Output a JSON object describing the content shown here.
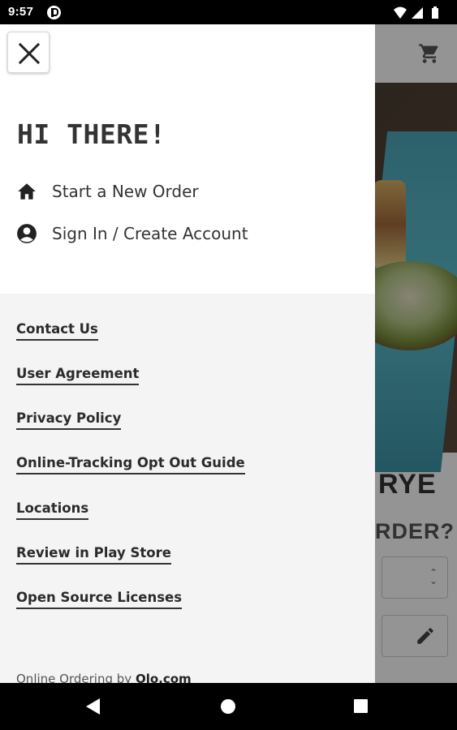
{
  "status_bar": {
    "time": "9:57"
  },
  "background": {
    "title_fragment": "RYE",
    "subtitle_fragment": "RDER?"
  },
  "drawer": {
    "greeting": "HI THERE!",
    "primary_items": [
      {
        "label": "Start a New Order",
        "icon": "home-icon"
      },
      {
        "label": "Sign In / Create Account",
        "icon": "account-circle-icon"
      }
    ],
    "links": [
      "Contact Us",
      "User Agreement",
      "Privacy Policy",
      "Online-Tracking Opt Out Guide",
      "Locations",
      "Review in Play Store",
      "Open Source Licenses"
    ],
    "footer_prefix": "Online Ordering by",
    "footer_brand": "Olo.com"
  },
  "colors": {
    "drawer_top": "#ffffff",
    "drawer_body": "#f4f4f4",
    "text_dark": "#333333"
  }
}
